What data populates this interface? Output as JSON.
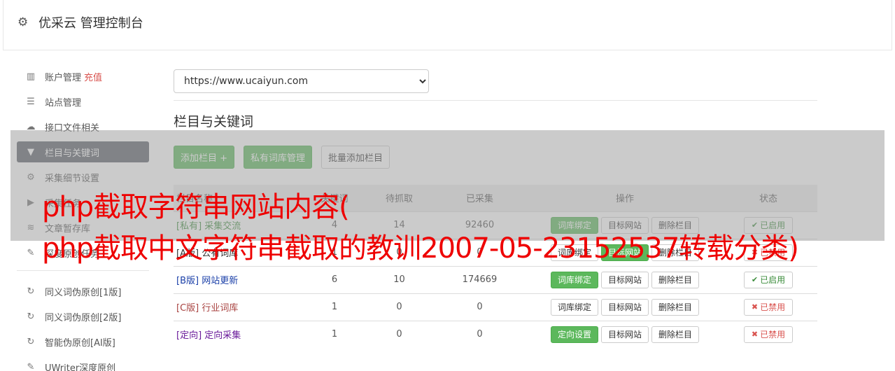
{
  "header": {
    "title": "优采云 管理控制台",
    "icon": "gear-icon"
  },
  "sidebar": {
    "items": [
      {
        "label": "账户管理",
        "extra": "充值",
        "icon": "bar-chart-icon",
        "glyph": "▥"
      },
      {
        "label": "站点管理",
        "icon": "server-icon",
        "glyph": "☰"
      },
      {
        "label": "接口文件相关",
        "icon": "cloud-upload-icon",
        "glyph": "☁"
      },
      {
        "label": "栏目与关键词",
        "icon": "filter-icon",
        "glyph": "▼",
        "active": true
      },
      {
        "label": "采集细节设置",
        "icon": "cogs-icon",
        "glyph": "⚙"
      },
      {
        "label": "采集任务",
        "icon": "play-icon",
        "glyph": "▶"
      },
      {
        "label": "文章暂存库",
        "icon": "database-icon",
        "glyph": "≋"
      },
      {
        "label": "深度原创任务",
        "icon": "edit-icon",
        "glyph": "✎"
      }
    ],
    "items2": [
      {
        "label": "同义词伪原创[1版]",
        "icon": "refresh-icon",
        "glyph": "↻"
      },
      {
        "label": "同义词伪原创[2版]",
        "icon": "refresh-icon",
        "glyph": "↻"
      },
      {
        "label": "智能伪原创[AI版]",
        "icon": "refresh-icon",
        "glyph": "↻"
      },
      {
        "label": "UWriter深度原创",
        "icon": "edit-icon",
        "glyph": "✎"
      }
    ]
  },
  "main": {
    "site": "https://www.ucaiyun.com",
    "section_title": "栏目与关键词",
    "buttons": {
      "add_column": "添加栏目 +",
      "private_lib": "私有词库管理",
      "batch_add": "批量添加栏目"
    },
    "table": {
      "headers": [
        "栏目名称",
        "关键词",
        "待抓取",
        "已采集",
        "操作",
        "状态"
      ],
      "rows": [
        {
          "tag": "[私有]",
          "name": "采集交流",
          "tag_color": "#3c8d3c",
          "keywords": "4",
          "pending": "14",
          "collected": "92460",
          "op1": "词库绑定",
          "op1_green": true,
          "op2": "目标网站",
          "op2_green": false,
          "op3": "删除栏目",
          "status": "已启用",
          "enabled": true
        },
        {
          "tag": "[A版]",
          "name": "公有词库",
          "tag_color": "#333333",
          "keywords": "1",
          "pending": "0",
          "collected": "0",
          "op1": "词库绑定",
          "op1_green": false,
          "op2": "目标网站",
          "op2_green": true,
          "op3": "删除栏目",
          "status": "已禁用",
          "enabled": false
        },
        {
          "tag": "[B版]",
          "name": "网站更新",
          "tag_color": "#1a3fa8",
          "keywords": "6",
          "pending": "10",
          "collected": "174669",
          "op1": "词库绑定",
          "op1_green": true,
          "op2": "目标网站",
          "op2_green": false,
          "op3": "删除栏目",
          "status": "已启用",
          "enabled": true
        },
        {
          "tag": "[C版]",
          "name": "行业词库",
          "tag_color": "#a94442",
          "keywords": "1",
          "pending": "0",
          "collected": "0",
          "op1": "词库绑定",
          "op1_green": false,
          "op2": "目标网站",
          "op2_green": false,
          "op3": "删除栏目",
          "status": "已禁用",
          "enabled": false
        },
        {
          "tag": "[定向]",
          "name": "定向采集",
          "tag_color": "#6a1b9a",
          "keywords": "1",
          "pending": "0",
          "collected": "0",
          "op1": "定向设置",
          "op1_green": true,
          "op2": "目标网站",
          "op2_green": false,
          "op3": "删除栏目",
          "status": "已禁用",
          "enabled": false
        }
      ]
    }
  },
  "watermark": {
    "line1": "php截取字符串网站内容(",
    "line2": "php截取中文字符串截取的教训2007-05-23152537转载分类)"
  },
  "colors": {
    "accent_green": "#5cb85c",
    "danger_red": "#d9534f",
    "sidebar_active": "#5b6068",
    "watermark": "#ee0000"
  }
}
